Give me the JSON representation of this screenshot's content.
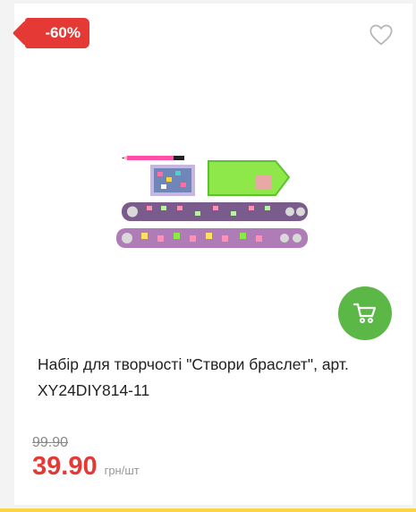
{
  "product": {
    "discount_badge": "-60%",
    "title": "Набір для творчості \"Створи браслет\", арт. XY24DIY814-11",
    "old_price": "99.90",
    "new_price": "39.90",
    "unit": "грн/шт"
  },
  "colors": {
    "badge": "#e53935",
    "cart_button": "#5cb846",
    "price": "#e53935",
    "bottom_bar": "#f7d64a"
  },
  "icons": {
    "favorite": "heart-icon",
    "cart": "shopping-cart-icon"
  }
}
